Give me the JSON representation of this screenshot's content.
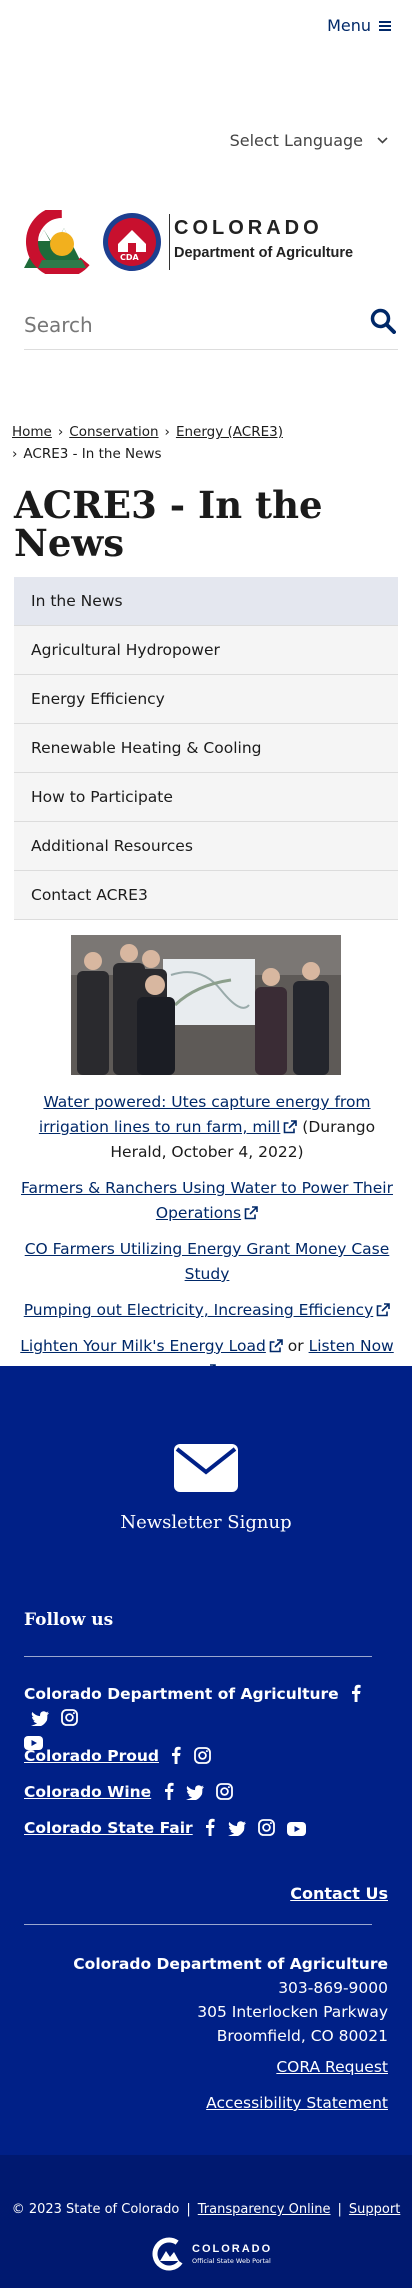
{
  "header": {
    "menu_label": "Menu",
    "language_label": "Select Language",
    "logo_title": "COLORADO",
    "logo_subtitle": "Department of Agriculture",
    "logo_badge": "CDA",
    "search_placeholder": "Search"
  },
  "breadcrumb": {
    "items": [
      "Home",
      "Conservation",
      "Energy (ACRE3)"
    ],
    "current": "ACRE3 - In the News"
  },
  "page": {
    "title": "ACRE3 - In the News"
  },
  "sidenav": {
    "items": [
      {
        "label": "In the News",
        "active": true
      },
      {
        "label": "Agricultural Hydropower"
      },
      {
        "label": "Energy Efficiency"
      },
      {
        "label": "Renewable Heating & Cooling"
      },
      {
        "label": "How to Participate"
      },
      {
        "label": "Additional Resources"
      },
      {
        "label": "Contact ACRE3"
      }
    ]
  },
  "content": {
    "article1_link": "Water powered: Utes capture energy from irrigation lines to run farm, mill",
    "article1_source": "(Durango Herald, October 4, 2022)",
    "article2_link": "Farmers & Ranchers Using Water to Power Their Operations",
    "article3_link": "CO Farmers Utilizing Energy Grant Money Case Study",
    "article4_link": "Pumping out Electricity, Increasing Efficiency",
    "article5_link": "Lighten Your Milk's Energy Load",
    "article5_or": "or",
    "article5_listen": "Listen Now"
  },
  "footer": {
    "newsletter_label": "Newsletter Signup",
    "follow_label": "Follow us",
    "social": [
      {
        "name": "Colorado Department of Agriculture",
        "icons": [
          "facebook-icon",
          "twitter-icon",
          "instagram-icon",
          "youtube-icon"
        ]
      },
      {
        "name": "Colorado Proud",
        "icons": [
          "facebook-icon",
          "instagram-icon"
        ]
      },
      {
        "name": "Colorado Wine",
        "icons": [
          "facebook-icon",
          "twitter-icon",
          "instagram-icon"
        ]
      },
      {
        "name": "Colorado State Fair",
        "icons": [
          "facebook-icon",
          "twitter-icon",
          "instagram-icon",
          "youtube-icon"
        ]
      }
    ],
    "contact_label": "Contact Us",
    "org_name": "Colorado Department of Agriculture",
    "phone": "303-869-9000",
    "street": "305 Interlocken Parkway",
    "city": "Broomfield, CO 80021",
    "cora_label": "CORA Request",
    "accessibility_label": "Accessibility Statement",
    "copyright": "© 2023 State of Colorado",
    "transparency_label": "Transparency Online",
    "support_label": "Support",
    "portal_title": "COLORADO",
    "portal_subtitle": "Official State Web Portal"
  },
  "colors": {
    "brand_blue": "#002868",
    "footer_bg": "#002087",
    "footer_bottom_bg": "#001970",
    "active_nav_bg": "#e4e7ef"
  }
}
